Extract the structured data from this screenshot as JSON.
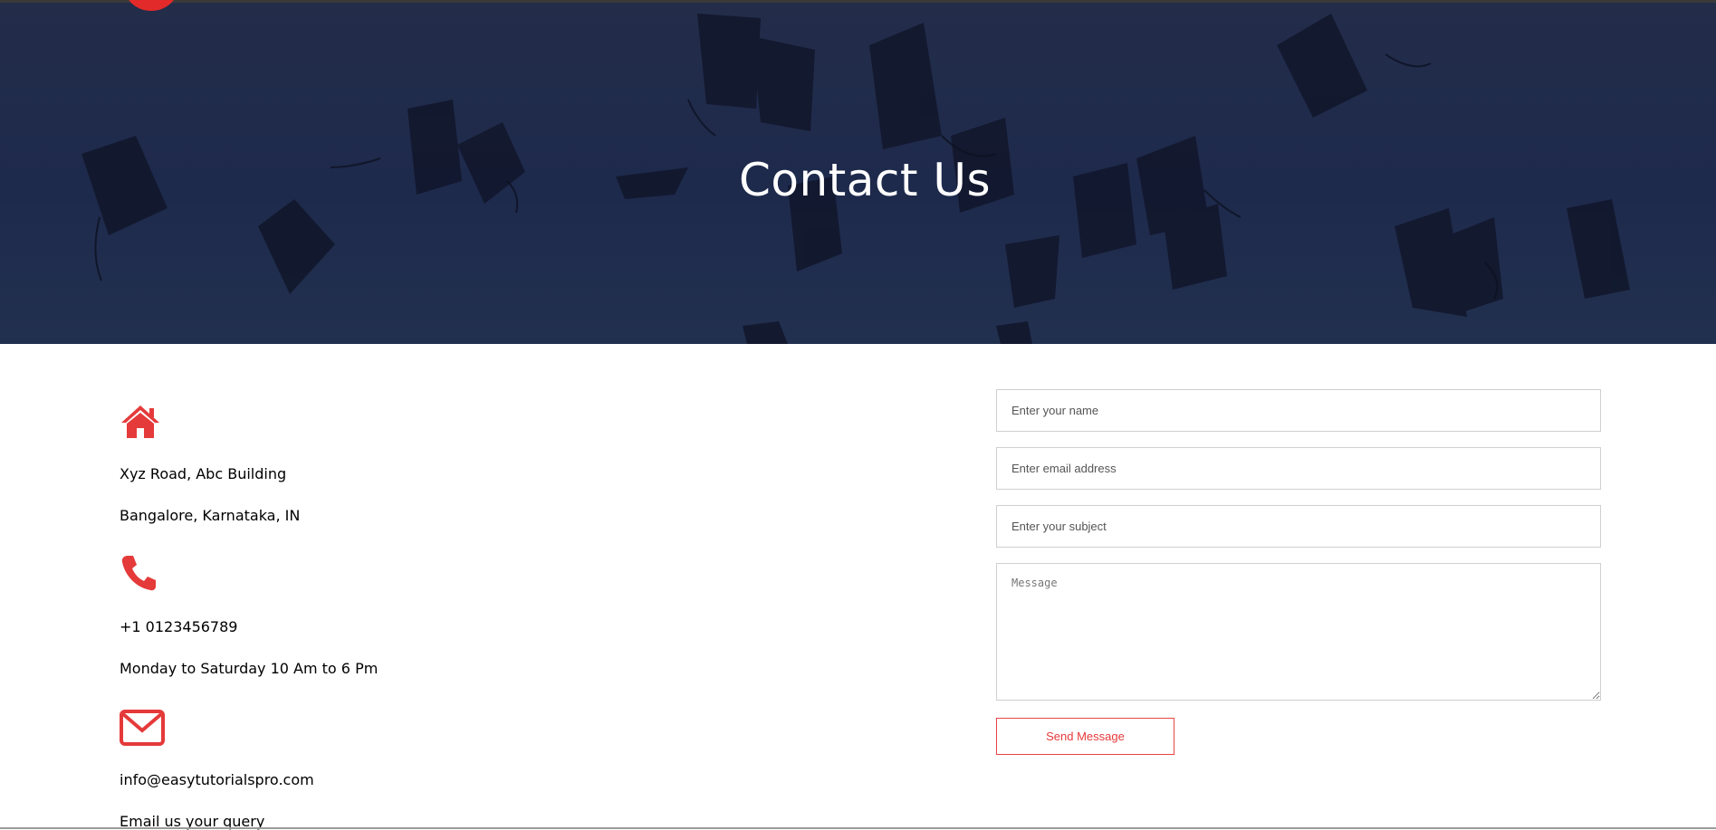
{
  "hero": {
    "title": "Contact Us"
  },
  "contact_info": {
    "address": {
      "icon": "home-icon",
      "main": "Xyz Road, Abc Building",
      "sub": "Bangalore, Karnataka, IN"
    },
    "phone": {
      "icon": "phone-icon",
      "main": "+1 0123456789",
      "sub": "Monday to Saturday 10 Am to 6 Pm"
    },
    "email": {
      "icon": "envelope-icon",
      "main": "info@easytutorialspro.com",
      "sub": "Email us your query"
    }
  },
  "form": {
    "name_placeholder": "Enter your name",
    "email_placeholder": "Enter email address",
    "subject_placeholder": "Enter your subject",
    "message_placeholder": "Message",
    "submit_label": "Send Message"
  },
  "colors": {
    "accent": "#e53a3a",
    "hero_overlay": "#1e2a4c"
  }
}
